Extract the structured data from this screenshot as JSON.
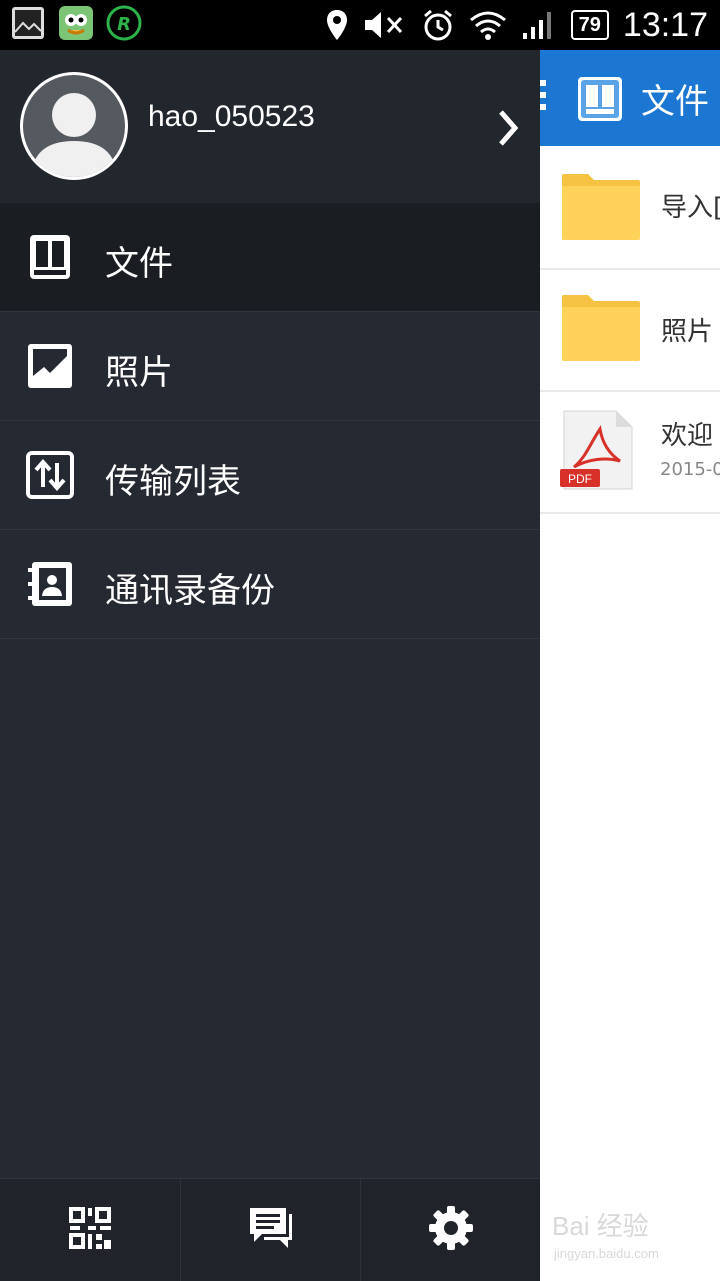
{
  "status_bar": {
    "battery": "79",
    "time": "13:17"
  },
  "drawer": {
    "username": "hao_050523",
    "menu": [
      {
        "label": "文件",
        "icon": "drive-icon",
        "active": true
      },
      {
        "label": "照片",
        "icon": "photo-icon",
        "active": false
      },
      {
        "label": "传输列表",
        "icon": "transfer-icon",
        "active": false
      },
      {
        "label": "通讯录备份",
        "icon": "contacts-icon",
        "active": false
      }
    ],
    "bottom_icons": [
      "qr-code-icon",
      "messages-icon",
      "settings-icon"
    ]
  },
  "app": {
    "title": "文件",
    "accent_color": "#1b77d1",
    "files": [
      {
        "name": "导入[",
        "type": "folder"
      },
      {
        "name": "照片",
        "type": "folder"
      },
      {
        "name": "欢迎",
        "date": "2015-0",
        "type": "pdf",
        "badge": "PDF"
      }
    ]
  },
  "watermark": {
    "text": "Bai 经验",
    "sub": "jingyan.baidu.com"
  }
}
